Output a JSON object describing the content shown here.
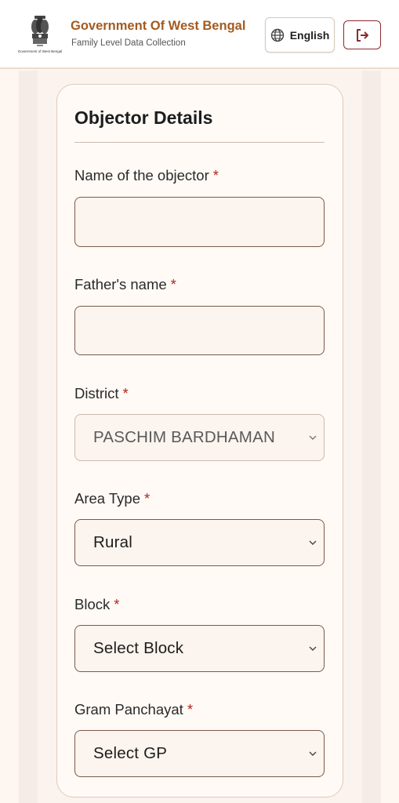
{
  "header": {
    "emblem_caption": "Government of West Bengal",
    "title": "Government Of West Bengal",
    "subtitle": "Family Level Data Collection",
    "language_label": "English",
    "language_icon": "globe-icon",
    "logout_icon": "logout-icon"
  },
  "form": {
    "title": "Objector Details",
    "required_mark": "*",
    "fields": {
      "objector_name": {
        "label": "Name of the objector",
        "value": ""
      },
      "father_name": {
        "label": "Father's name",
        "value": ""
      },
      "district": {
        "label": "District",
        "value": "PASCHIM BARDHAMAN",
        "disabled": true
      },
      "area_type": {
        "label": "Area Type",
        "value": "Rural"
      },
      "block": {
        "label": "Block",
        "value": "Select Block"
      },
      "gram_panchayat": {
        "label": "Gram Panchayat",
        "value": "Select GP"
      }
    }
  },
  "colors": {
    "brand": "#a35a1f",
    "required": "#b3261e",
    "field_border": "#7a5a47",
    "logout_border": "#8b2a2a"
  }
}
